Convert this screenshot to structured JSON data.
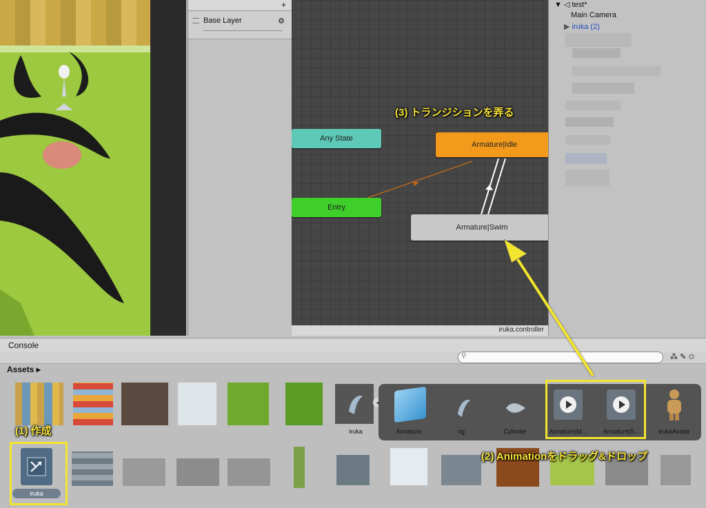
{
  "layers": {
    "add_label": "+",
    "base_layer": "Base Layer",
    "gear": "⚙"
  },
  "animator": {
    "states": {
      "any_state": "Any State",
      "entry": "Entry",
      "idle": "Armature|Idle",
      "swim": "Armature|Swim"
    },
    "controller_file": "iruka.controller"
  },
  "hierarchy": {
    "scene": "test*",
    "main_camera": "Main Camera",
    "iruka": "iruka (2)"
  },
  "console": {
    "tab": "Console"
  },
  "assets": {
    "header": "Assets",
    "items": [
      "iruka",
      "Armature",
      "rig",
      "Cylinder",
      "Armature|Id...",
      "Armature|S...",
      "irukaAvatar"
    ],
    "created_item": "iruka"
  },
  "annotations": {
    "step1": "(1) 作成",
    "step2": "(2) Animationをドラッグ&ドロップ",
    "step3": "(3) トランジションを弄る"
  },
  "colors": {
    "any_state": "#5ec9b6",
    "entry": "#3fcf2a",
    "idle": "#f39a1c",
    "highlight": "#f3e52d"
  }
}
